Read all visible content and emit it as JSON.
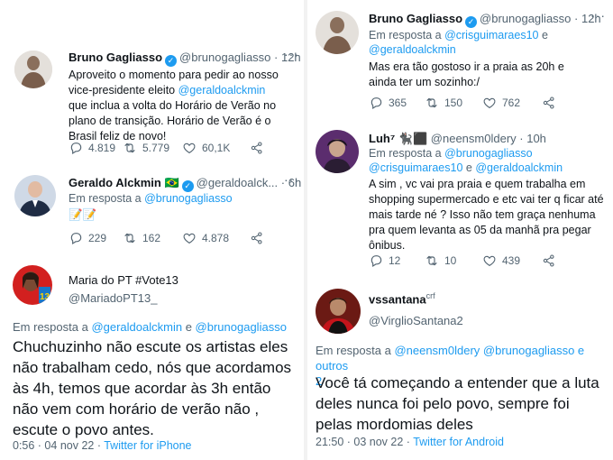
{
  "left": {
    "tweet1": {
      "name": "Bruno Gagliasso",
      "handle": "@brunogagliasso",
      "time": "12h",
      "text_pre": "Aproveito o momento para pedir ao nosso vice-presidente eleito ",
      "mention": "@geraldoalckmin",
      "text_post": " que inclua a volta do Horário de Verão no plano de transição. Horário de Verão é o Brasil feliz de novo!",
      "replies": "4.819",
      "retweets": "5.779",
      "likes": "60,1K"
    },
    "tweet2": {
      "name": "Geraldo Alckmin",
      "flag": "🇧🇷",
      "handle": "@geraldoalck...",
      "time": "6h",
      "reply_prefix": "Em resposta a ",
      "reply_to": "@brunogagliasso",
      "text": "📝📝",
      "replies": "229",
      "retweets": "162",
      "likes": "4.878"
    },
    "tweet3": {
      "name": "Maria do PT #Vote13",
      "handle": "@MariadoPT13_",
      "reply_prefix": "Em resposta a ",
      "reply_to_1": "@geraldoalckmin",
      "reply_and": " e ",
      "reply_to_2": "@brunogagliasso",
      "text": "Chuchuzinho não escute os artistas eles não trabalham cedo, nós que acordamos às 4h, temos que acordar às 3h então não vem com horário de verão não , escute o povo antes.",
      "time": "0:56 · 04 nov 22 · ",
      "client": "Twitter for iPhone"
    }
  },
  "right": {
    "tweet1": {
      "name": "Bruno Gagliasso",
      "handle": "@brunogagliasso",
      "time": "12h",
      "reply_prefix": "Em resposta a ",
      "reply_to_1": "@crisguimaraes10",
      "reply_and": " e",
      "reply_to_2": "@geraldoalckmin",
      "text": "Mas era tão gostoso ir a praia as 20h e ainda ter um sozinho:/",
      "replies": "365",
      "retweets": "150",
      "likes": "762"
    },
    "tweet2": {
      "name": "Luh⁷ 🐈‍⬛⬛",
      "handle": "@neensm0ldery",
      "time": "10h",
      "reply_prefix": "Em resposta a ",
      "reply_to_1": "@brunogagliasso",
      "reply_to_2": "@crisguimaraes10",
      "reply_and": " e ",
      "reply_to_3": "@geraldoalckmin",
      "text": "A sim , vc vai pra praia e quem trabalha em shopping supermercado e etc vai ter q ficar até mais tarde né ? Isso não tem graça nenhuma pra quem levanta as 05 da manhã pra pegar ônibus.",
      "replies": "12",
      "retweets": "10",
      "likes": "439"
    },
    "tweet3": {
      "name": "vssantana",
      "name_sup": "crf",
      "handle": "@VirglioSantana2",
      "reply_prefix": "Em resposta a ",
      "reply_to_1": "@neensm0ldery",
      "reply_to_2": "@brunogagliasso",
      "reply_and": " e outros",
      "reply_and_2": "2",
      "text": "Você tá começando a entender que a luta deles nunca foi pelo povo, sempre foi pelas mordomias deles",
      "time": "21:50 · 03 nov 22 · ",
      "client": "Twitter for Android"
    }
  },
  "colors": {
    "link": "#1d9bf0",
    "muted": "#536471",
    "text": "#0f1419",
    "verified": "#1d9bf0"
  }
}
